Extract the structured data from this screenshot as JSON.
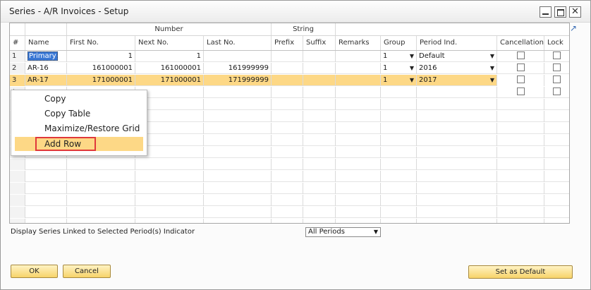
{
  "window": {
    "title": "Series - A/R Invoices - Setup",
    "controls": [
      "minimize",
      "maximize",
      "close"
    ],
    "close_glyph": "✕"
  },
  "grid": {
    "group_headers": {
      "number": "Number",
      "string": "String"
    },
    "columns": [
      "#",
      "Name",
      "First No.",
      "Next No.",
      "Last No.",
      "Prefix",
      "Suffix",
      "Remarks",
      "Group",
      "Period Ind.",
      "Cancellation",
      "Lock"
    ],
    "rows": [
      {
        "num": "1",
        "name": "Primary",
        "first": "1",
        "next": "1",
        "last": "",
        "prefix": "",
        "suffix": "",
        "remarks": "",
        "group": "1",
        "period": "Default",
        "cancellation": false,
        "lock": false,
        "selected": false
      },
      {
        "num": "2",
        "name": "AR-16",
        "first": "161000001",
        "next": "161000001",
        "last": "161999999",
        "prefix": "",
        "suffix": "",
        "remarks": "",
        "group": "1",
        "period": "2016",
        "cancellation": false,
        "lock": false,
        "selected": false
      },
      {
        "num": "3",
        "name": "AR-17",
        "first": "171000001",
        "next": "171000001",
        "last": "171999999",
        "prefix": "",
        "suffix": "",
        "remarks": "",
        "group": "1",
        "period": "2017",
        "cancellation": false,
        "lock": false,
        "selected": true
      }
    ],
    "new_row_marker": "*"
  },
  "context_menu": {
    "items": [
      {
        "label": "Copy",
        "highlighted": false
      },
      {
        "label": "Copy Table",
        "highlighted": false
      },
      {
        "label": "Maximize/Restore Grid",
        "highlighted": false
      },
      {
        "label": "Add Row",
        "highlighted": true
      }
    ]
  },
  "footer": {
    "label": "Display Series Linked to Selected Period(s) Indicator",
    "period_select": "All Periods"
  },
  "buttons": {
    "ok": "OK",
    "cancel": "Cancel",
    "set_default": "Set as Default"
  },
  "colors": {
    "selection": "#fdd886",
    "highlight_outline": "#e0383b",
    "button": "#f7d36a"
  }
}
